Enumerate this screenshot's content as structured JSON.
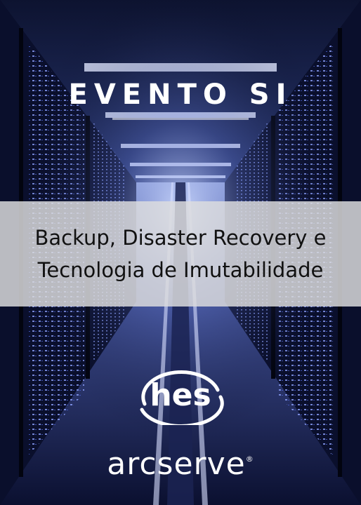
{
  "event": {
    "title": "EVENTO SI"
  },
  "banner": {
    "line1": "Backup, Disaster Recovery e",
    "line2": "Tecnologia de Imutabilidade"
  },
  "logos": {
    "hes": "hes",
    "arcserve": "arcserve",
    "arcserve_mark": "®"
  },
  "colors": {
    "background": "#05081a",
    "corridor_light": "#b8c8f0",
    "server_led": "#6f86ff",
    "banner": "#dcdcde",
    "text_dark": "#111111",
    "text_light": "#ffffff"
  },
  "icons": [
    "hes-logo-icon",
    "server-rack-icon"
  ]
}
